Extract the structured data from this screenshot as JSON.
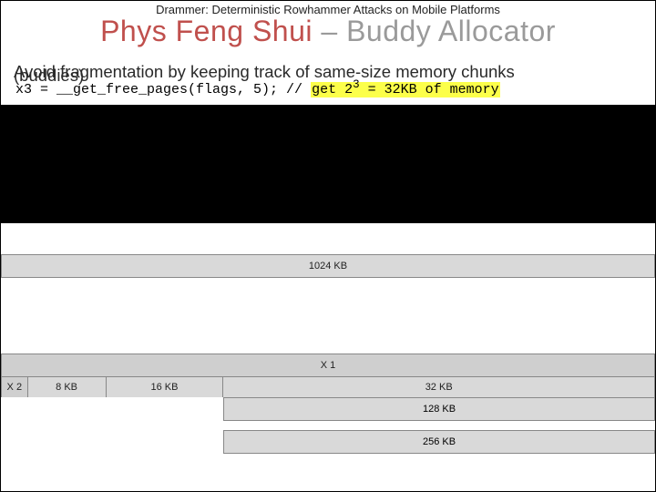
{
  "supertitle": "Drammer: Deterministic Rowhammer Attacks on Mobile Platforms",
  "title_a": "Phys Feng Shui",
  "title_sep": " – ",
  "title_b": "Buddy Allocator",
  "lead": "Avoid fragmentation by keeping track of same-size memory chunks",
  "buddies": "(buddies)",
  "code_prefix": "x3 = __get_free_pages(flags, 5); // ",
  "code_hl": "get 2",
  "code_sup": "3",
  "code_hl_tail": " = 32KB of memory",
  "labels": {
    "k1024": "1024 KB",
    "x1": "X 1",
    "x2": "X 2",
    "k8": "8 KB",
    "k16": "16 KB",
    "k32": "32 KB",
    "k128": "128 KB",
    "k256": "256 KB"
  }
}
